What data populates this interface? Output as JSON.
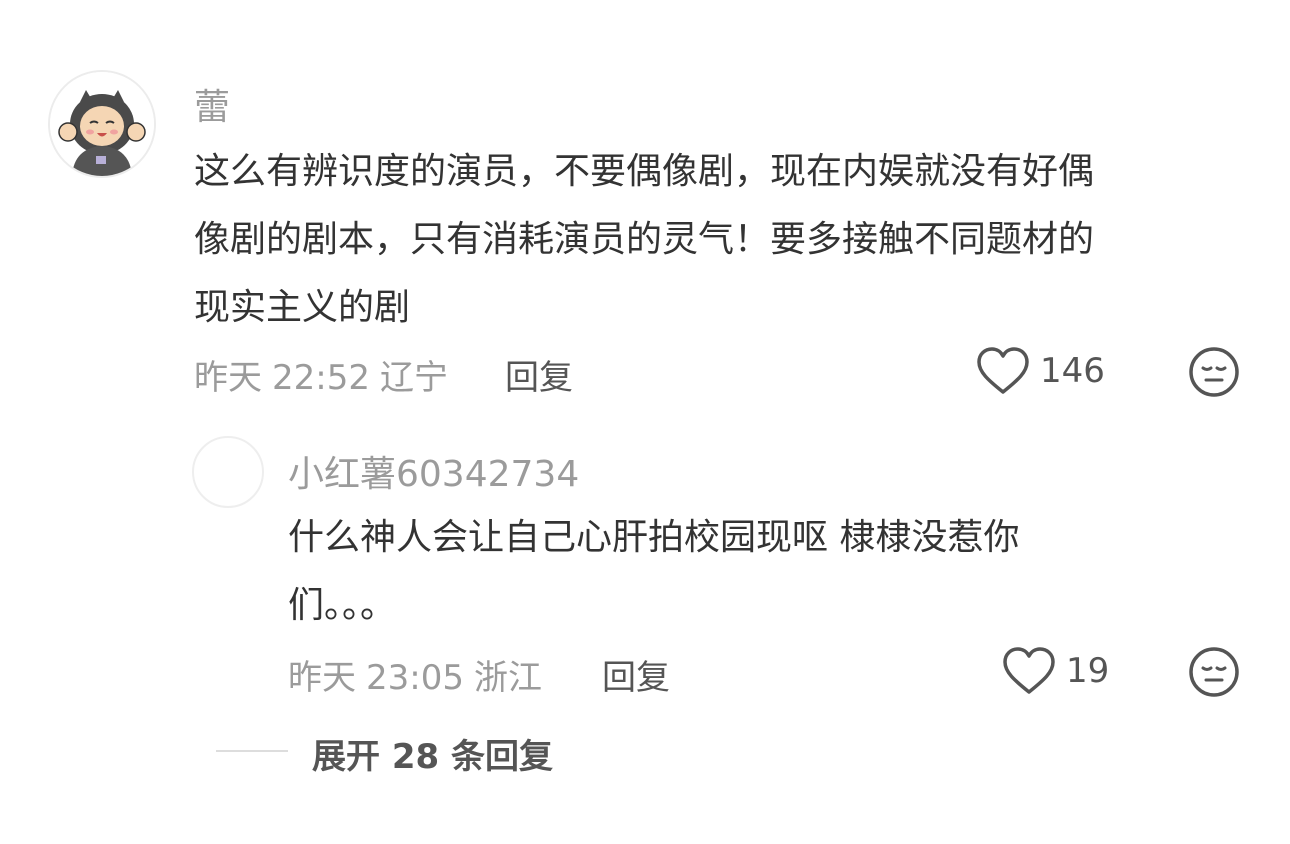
{
  "comment": {
    "username": "蕾",
    "text_lines": [
      "这么有辨识度的演员，不要偶像剧，现在内娱就没有好偶",
      "像剧的剧本，只有消耗演员的灵气！要多接触不同题材的",
      "现实主义的剧"
    ],
    "date": "昨天",
    "time": "22:52",
    "location": "辽宁",
    "reply_label": "回复",
    "like_count": "146",
    "like_icon": "heart-outline-icon",
    "emoji_icon": "expressionless-face-icon"
  },
  "reply": {
    "username": "小红薯60342734",
    "text_lines": [
      "什么神人会让自己心肝拍校园现呕 棣棣没惹你",
      "们。。。"
    ],
    "date": "昨天",
    "time": "23:05",
    "location": "浙江",
    "reply_label": "回复",
    "like_count": "19",
    "like_icon": "heart-outline-icon",
    "emoji_icon": "expressionless-face-icon"
  },
  "expand_replies": {
    "label": "展开 28 条回复"
  },
  "colors": {
    "primary_text": "#333333",
    "secondary_text": "#9b9b9b",
    "icon": "#555555"
  }
}
